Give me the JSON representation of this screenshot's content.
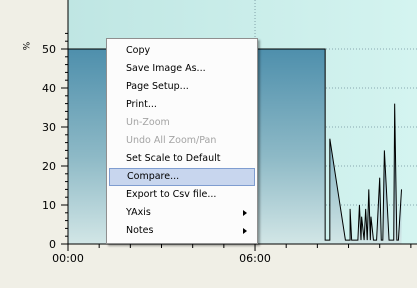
{
  "chart_data": {
    "type": "area",
    "y_unit_label": "%",
    "ylim": [
      0,
      55
    ],
    "y_ticks": [
      0,
      10,
      20,
      30,
      40,
      50
    ],
    "x_tick_labels": [
      "00:00",
      "06:00"
    ],
    "grid": true,
    "colors": {
      "plot_background": "#c6ebe7",
      "area_fill_top": "#4f8fad",
      "area_fill_bottom": "#cfe3e6",
      "area_line": "#000000"
    },
    "series": [
      {
        "x_hours": [
          0,
          0,
          8.25,
          8.25,
          8.4,
          8.4,
          8.9,
          9.05,
          9.05,
          9.1,
          9.3,
          9.35,
          9.4,
          9.42,
          9.5,
          9.55,
          9.6,
          9.65,
          9.7,
          9.72,
          9.8,
          9.9,
          10.0,
          10.05,
          10.1,
          10.15,
          10.3,
          10.45,
          10.48,
          10.55,
          10.6,
          10.7
        ],
        "values": [
          0,
          50,
          50,
          1,
          1,
          27,
          1,
          1,
          9,
          1,
          1,
          10,
          1,
          7,
          1,
          9,
          1,
          14,
          1,
          7,
          1,
          1,
          17,
          1,
          1,
          24,
          1,
          1,
          36,
          1,
          1,
          14
        ]
      }
    ]
  },
  "context_menu": {
    "items": [
      {
        "label": "Copy",
        "state": "normal",
        "submenu": false
      },
      {
        "label": "Save Image As...",
        "state": "normal",
        "submenu": false
      },
      {
        "label": "Page Setup...",
        "state": "normal",
        "submenu": false
      },
      {
        "label": "Print...",
        "state": "normal",
        "submenu": false
      },
      {
        "label": "Un-Zoom",
        "state": "disabled",
        "submenu": false
      },
      {
        "label": "Undo All Zoom/Pan",
        "state": "disabled",
        "submenu": false
      },
      {
        "label": "Set Scale to Default",
        "state": "normal",
        "submenu": false
      },
      {
        "label": "Compare...",
        "state": "highlighted",
        "submenu": false
      },
      {
        "label": "Export to Csv file...",
        "state": "normal",
        "submenu": false
      },
      {
        "label": "YAxis",
        "state": "normal",
        "submenu": true
      },
      {
        "label": "Notes",
        "state": "normal",
        "submenu": true
      }
    ]
  }
}
